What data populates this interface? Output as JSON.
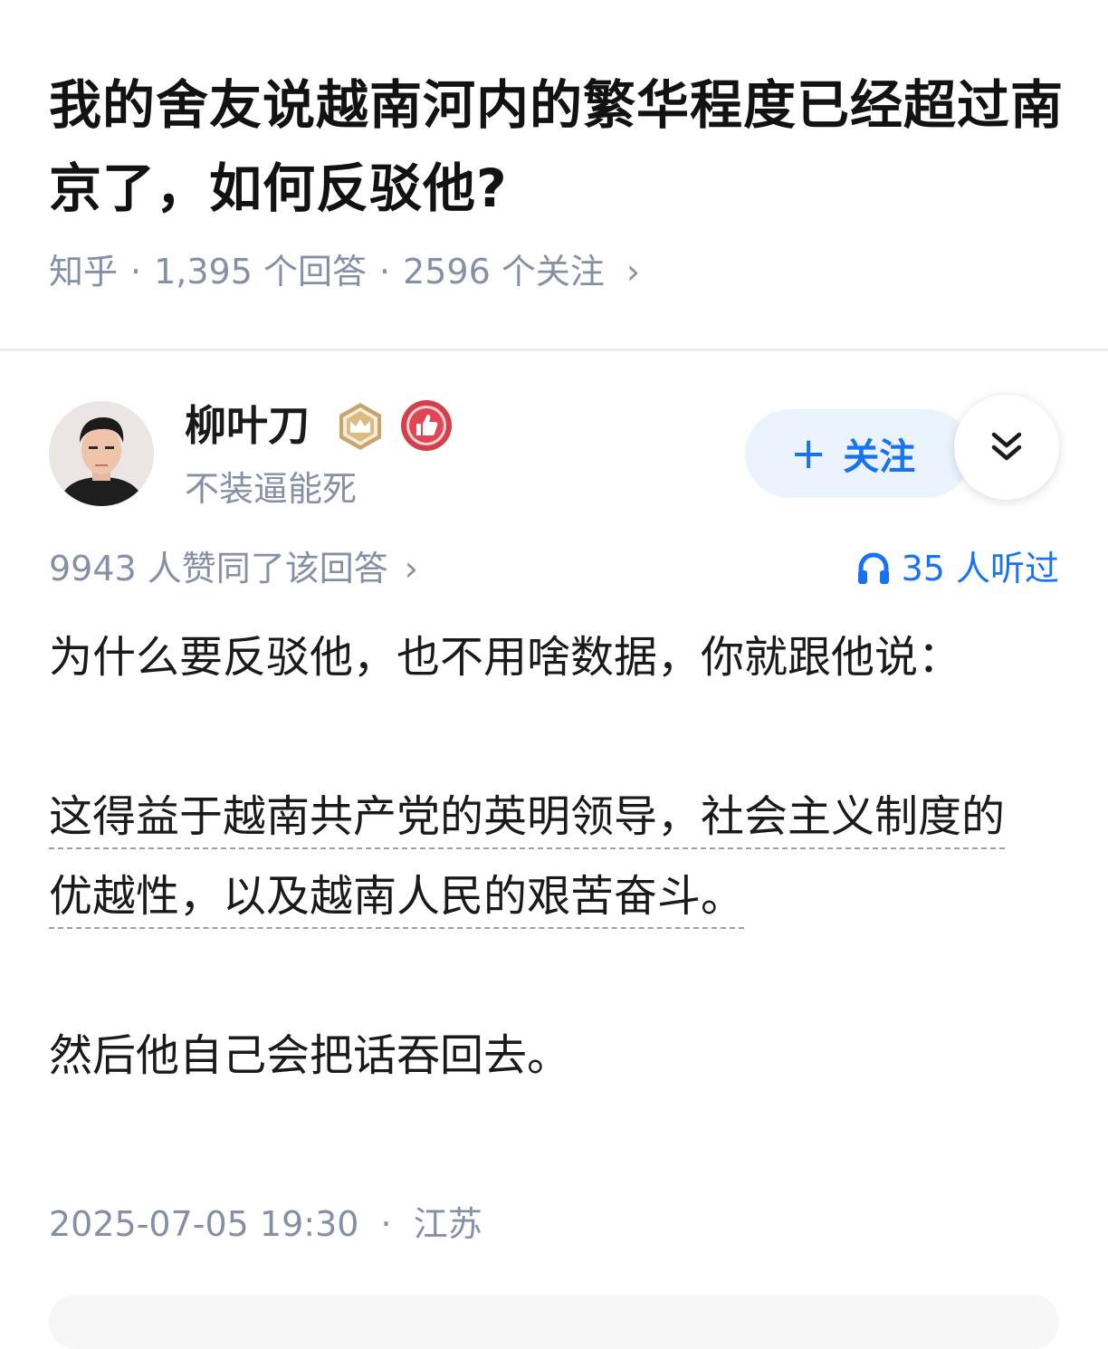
{
  "question": {
    "title": "我的舍友说越南河内的繁华程度已经超过南京了，如何反驳他?",
    "source": "知乎",
    "answer_count": "1,395 个回答",
    "follower_count": "2596 个关注",
    "separator": "·",
    "chevron": "›"
  },
  "author": {
    "name": "柳叶刀",
    "bio": "不装逼能死",
    "badges": [
      "crown-badge-icon",
      "thumbs-up-badge-icon"
    ]
  },
  "actions": {
    "follow_plus": "+",
    "follow_label": "关注",
    "expand_icon": "double-chevron-down-icon"
  },
  "stats": {
    "votes": "9943 人赞同了该回答",
    "chevron": "›",
    "listeners": "35 人听过"
  },
  "answer": {
    "para1": "为什么要反驳他，也不用啥数据，你就跟他说：",
    "para2": "这得益于越南共产党的英明领导，社会主义制度的优越性，以及越南人民的艰苦奋斗。",
    "para3": "然后他自己会把话吞回去。"
  },
  "footer": {
    "timestamp": "2025-07-05 19:30",
    "separator": "·",
    "location": "江苏"
  },
  "colors": {
    "accent": "#1772f6",
    "meta_gray": "#8590a6",
    "follow_bg": "#ebf3fe"
  }
}
